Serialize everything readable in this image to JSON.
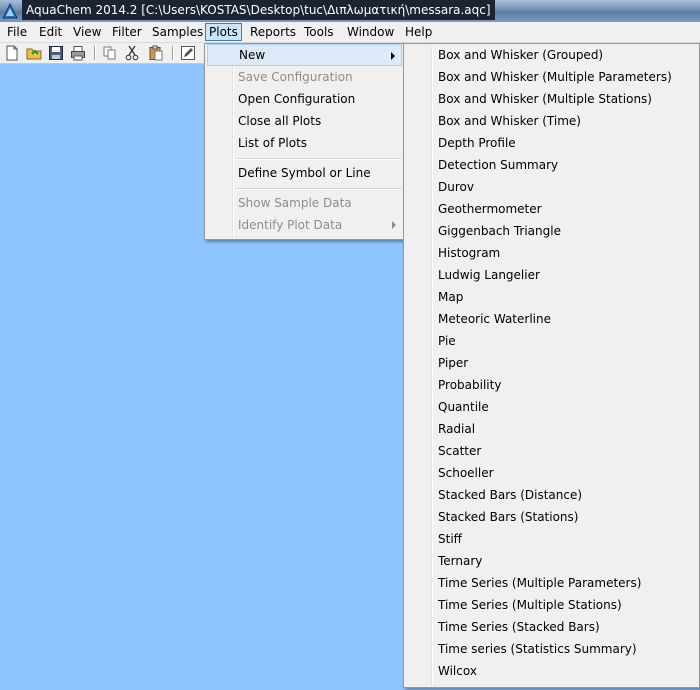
{
  "window": {
    "title": "AquaChem 2014.2 [C:\\Users\\KOSTAS\\Desktop\\tuc\\Διπλωματική\\messara.aqc]"
  },
  "menubar": {
    "items": [
      {
        "label": "File"
      },
      {
        "label": "Edit"
      },
      {
        "label": "View"
      },
      {
        "label": "Filter"
      },
      {
        "label": "Samples"
      },
      {
        "label": "Plots"
      },
      {
        "label": "Reports"
      },
      {
        "label": "Tools"
      },
      {
        "label": "Window"
      },
      {
        "label": "Help"
      }
    ]
  },
  "toolbar": {
    "icons": [
      "new-file-icon",
      "open-folder-icon",
      "save-icon",
      "print-icon",
      "copy-icon",
      "cut-icon",
      "paste-icon",
      "edit-icon"
    ]
  },
  "plots_menu": {
    "items": [
      {
        "label": "New",
        "enabled": true,
        "submenu": true
      },
      {
        "label": "Save Configuration",
        "enabled": false
      },
      {
        "label": "Open Configuration",
        "enabled": true
      },
      {
        "label": "Close all Plots",
        "enabled": true
      },
      {
        "label": "List of Plots",
        "enabled": true
      },
      {
        "label": "Define Symbol or Line",
        "enabled": true
      },
      {
        "label": "Show Sample Data",
        "enabled": false
      },
      {
        "label": "Identify Plot Data",
        "enabled": false,
        "submenu": true
      }
    ]
  },
  "new_submenu": {
    "items": [
      "Box and Whisker (Grouped)",
      "Box and Whisker (Multiple Parameters)",
      "Box and Whisker (Multiple Stations)",
      "Box and Whisker (Time)",
      "Depth Profile",
      "Detection Summary",
      "Durov",
      "Geothermometer",
      "Giggenbach Triangle",
      "Histogram",
      "Ludwig Langelier",
      "Map",
      "Meteoric Waterline",
      "Pie",
      "Piper",
      "Probability",
      "Quantile",
      "Radial",
      "Scatter",
      "Schoeller",
      "Stacked Bars (Distance)",
      "Stacked Bars (Stations)",
      "Stiff",
      "Ternary",
      "Time Series (Multiple Parameters)",
      "Time Series (Multiple Stations)",
      "Time Series (Stacked Bars)",
      "Time series (Statistics Summary)",
      "Wilcox"
    ]
  },
  "colors": {
    "workspace": "#8ec4ff",
    "menu_bg": "#f0f0f0",
    "highlight": "#dce9f7"
  }
}
